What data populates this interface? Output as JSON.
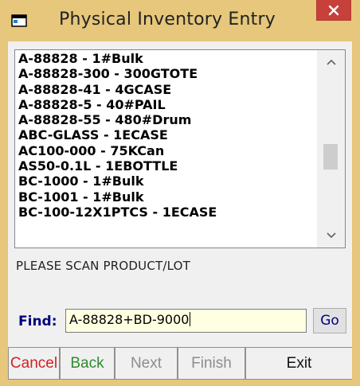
{
  "window": {
    "title": "Physical Inventory Entry",
    "close_glyph": "×",
    "title_bar_color": "#e6c77b"
  },
  "product_list": {
    "items": [
      "A-88828 - 1#Bulk",
      "A-88828-300 - 300GTOTE",
      "A-88828-41 - 4GCASE",
      "A-88828-5 - 40#PAIL",
      "A-88828-55 - 480#Drum",
      "ABC-GLASS - 1ECASE",
      "AC100-000 - 75KCan",
      "AS50-0.1L - 1EBOTTLE",
      "BC-1000 - 1#Bulk",
      "BC-1001 - 1#Bulk",
      "BC-100-12X1PTCS - 1ECASE"
    ],
    "scroll_up_icon": "chevron-up-icon",
    "scroll_down_icon": "chevron-down-icon"
  },
  "status": {
    "message": "PLEASE SCAN PRODUCT/LOT"
  },
  "find": {
    "label": "Find:",
    "value": "A-88828+BD-9000",
    "go_label": "Go"
  },
  "buttons": {
    "cancel": "Cancel",
    "back": "Back",
    "next": "Next",
    "finish": "Finish",
    "exit": "Exit"
  },
  "colors": {
    "cancel": "#d42020",
    "back": "#2e8b2e",
    "disabled": "#8d8d8d",
    "find_label": "#000080",
    "find_background": "#ffffe1",
    "close_button": "#c7403a"
  }
}
